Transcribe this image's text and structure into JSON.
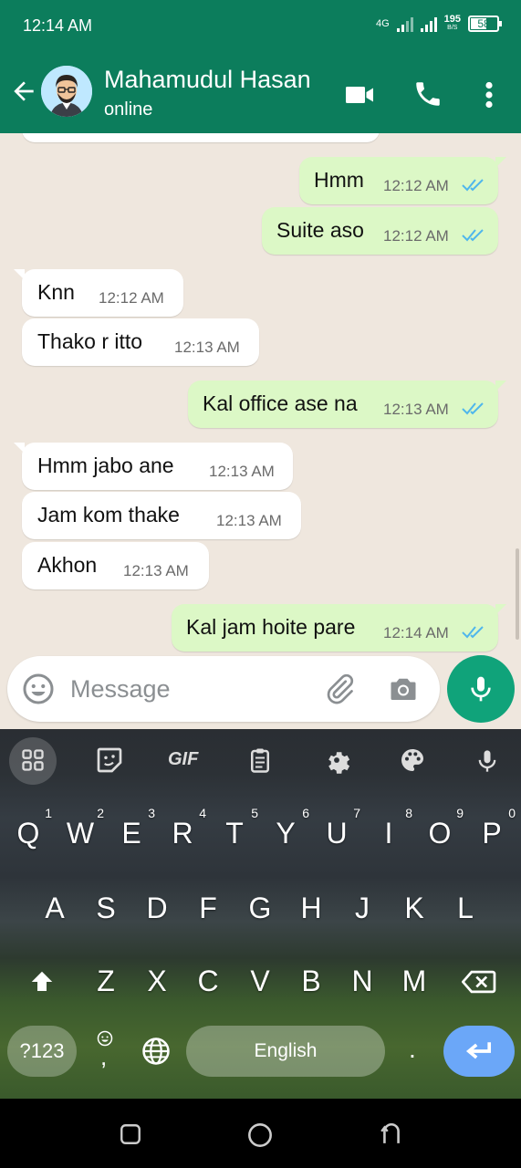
{
  "status_bar": {
    "time": "12:14 AM",
    "network_type": "4G",
    "net_speed_value": "195",
    "net_speed_unit": "B/S",
    "battery": "58"
  },
  "header": {
    "contact_name": "Mahamudul Hasan",
    "contact_status": "online"
  },
  "messages": [
    {
      "direction": "out",
      "text": "Hmm",
      "time": "12:12 AM",
      "read": true
    },
    {
      "direction": "out",
      "text": "Suite aso",
      "time": "12:12 AM",
      "read": true
    },
    {
      "direction": "in",
      "text": "Knn",
      "time": "12:12 AM"
    },
    {
      "direction": "in",
      "text": "Thako r itto",
      "time": "12:13 AM"
    },
    {
      "direction": "out",
      "text": "Kal office ase na",
      "time": "12:13 AM",
      "read": true
    },
    {
      "direction": "in",
      "text": "Hmm jabo ane",
      "time": "12:13 AM"
    },
    {
      "direction": "in",
      "text": "Jam kom thake",
      "time": "12:13 AM"
    },
    {
      "direction": "in",
      "text": "Akhon",
      "time": "12:13 AM"
    },
    {
      "direction": "out",
      "text": "Kal jam hoite pare",
      "time": "12:14 AM",
      "read": true
    }
  ],
  "composer": {
    "placeholder": "Message"
  },
  "keyboard": {
    "toolbar_gif": "GIF",
    "row1": [
      {
        "key": "Q",
        "hint": "1"
      },
      {
        "key": "W",
        "hint": "2"
      },
      {
        "key": "E",
        "hint": "3"
      },
      {
        "key": "R",
        "hint": "4"
      },
      {
        "key": "T",
        "hint": "5"
      },
      {
        "key": "Y",
        "hint": "6"
      },
      {
        "key": "U",
        "hint": "7"
      },
      {
        "key": "I",
        "hint": "8"
      },
      {
        "key": "O",
        "hint": "9"
      },
      {
        "key": "P",
        "hint": "0"
      }
    ],
    "row2": [
      "A",
      "S",
      "D",
      "F",
      "G",
      "H",
      "J",
      "K",
      "L"
    ],
    "row3": [
      "Z",
      "X",
      "C",
      "V",
      "B",
      "N",
      "M"
    ],
    "symbols_key": "?123",
    "comma_key": ",",
    "space_label": "English",
    "period_key": "."
  },
  "colors": {
    "header": "#0c7d5c",
    "outgoing_bubble": "#dcf8c6",
    "incoming_bubble": "#ffffff",
    "read_ticks": "#4fb6ec",
    "mic_button": "#10a37a",
    "enter_key": "#6ba7f8"
  }
}
